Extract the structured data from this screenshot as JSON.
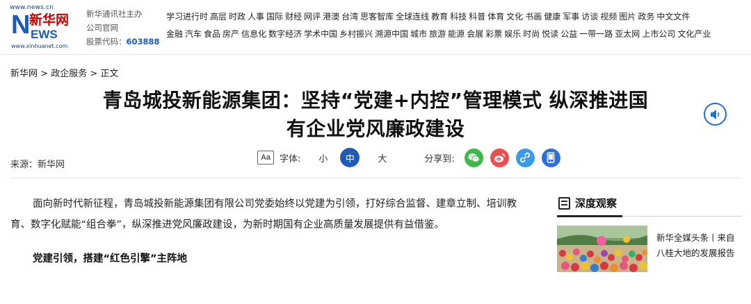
{
  "logo": {
    "url": "www.news.cn",
    "cn_name": "新华网",
    "brand_n": "N",
    "brand_ews": "EWS",
    "url2": "www.xinhuanet.com"
  },
  "org": {
    "line1": "新华通讯社主办",
    "line2": "公司官网",
    "stock_label": "股票代码：",
    "stock_code": "603888"
  },
  "nav": {
    "row1": [
      "学习进行时",
      "高层",
      "时政",
      "人事",
      "国际",
      "财经",
      "网评",
      "港澳",
      "台湾",
      "思客智库",
      "全球连线",
      "教育",
      "科技",
      "科普",
      "体育",
      "文化",
      "书画",
      "健康",
      "军事",
      "访谈",
      "视频",
      "图片",
      "政务",
      "中文文件"
    ],
    "row2": [
      "金融",
      "汽车",
      "食品",
      "房产",
      "信息化",
      "数字经济",
      "学术中国",
      "乡村振兴",
      "溯源中国",
      "城市",
      "旅游",
      "能源",
      "会展",
      "彩票",
      "娱乐",
      "时尚",
      "悦读",
      "公益",
      "一带一路",
      "亚太网",
      "上市公司",
      "文化产业"
    ]
  },
  "breadcrumb": {
    "home": "新华网",
    "sep1": " > ",
    "section": "政企服务",
    "sep2": " > ",
    "current": "正文"
  },
  "article": {
    "title_line1": "青岛城投新能源集团：坚持“党建+内控”管理模式 纵深推进国",
    "title_line2": "有企业党风廉政建设",
    "source": "来源：新华网",
    "paragraph1": "面向新时代新征程，青岛城投新能源集团有限公司党委始终以党建为引领，打好综合监督、建章立制、培训教育、数字化赋能“组合拳”，纵深推进党风廉政建设，为新时期国有企业高质量发展提供有益借鉴。",
    "subhead1": "党建引领，搭建“红色引擎”主阵地"
  },
  "toolbar": {
    "aa_icon_text": "Aa",
    "font_size_label": "字体:",
    "size_small": "小",
    "size_medium": "中",
    "size_large": "大",
    "share_label": "分享到:"
  },
  "share": {
    "wechat_color": "#3fb84a",
    "weibo_color": "#e8504f",
    "link_color": "#3a9ae8",
    "mobile_color": "#2f6fdc"
  },
  "sidebar": {
    "title": "深度观察",
    "item_text": "新华全媒头条丨来自八桂大地的发展报告"
  },
  "colors": {
    "brand_blue": "#1d5bb5",
    "brand_red": "#cc0000"
  }
}
